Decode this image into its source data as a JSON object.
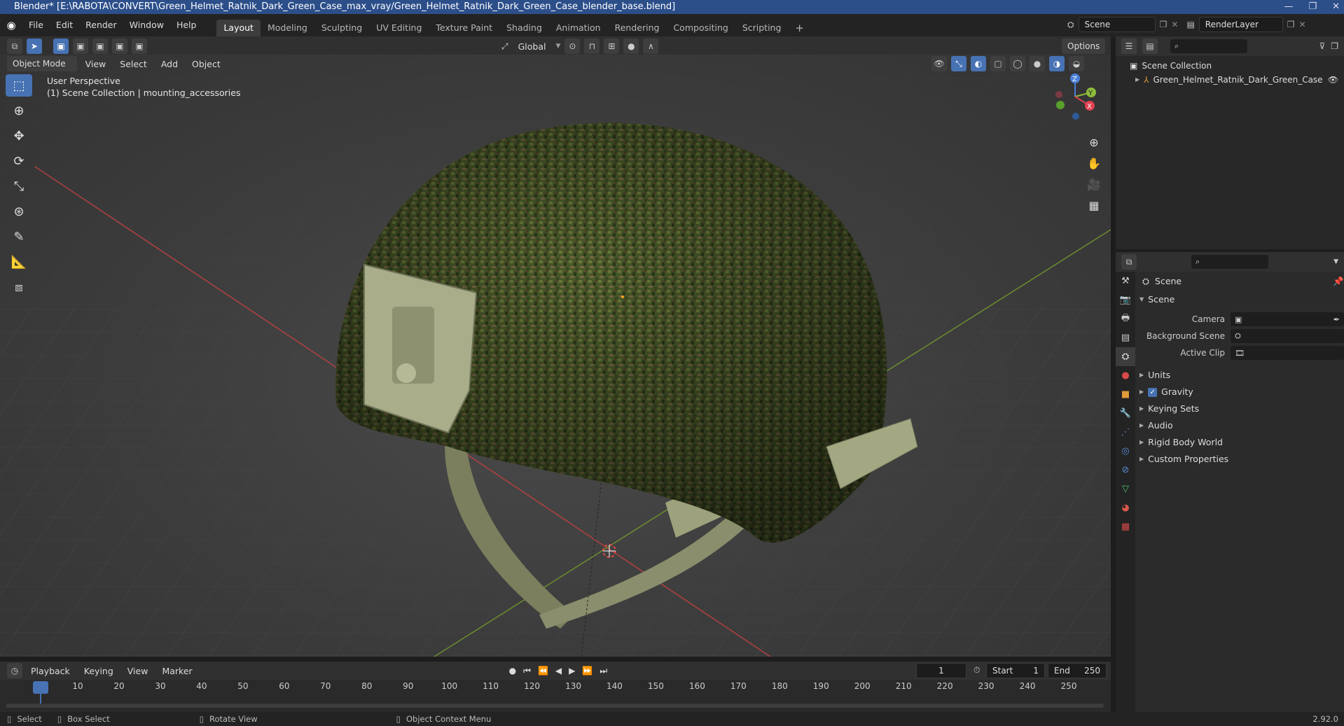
{
  "window": {
    "title": "Blender* [E:\\RABOTA\\CONVERT\\Green_Helmet_Ratnik_Dark_Green_Case_max_vray/Green_Helmet_Ratnik_Dark_Green_Case_blender_base.blend]"
  },
  "menu": [
    "File",
    "Edit",
    "Render",
    "Window",
    "Help"
  ],
  "workspaces": [
    {
      "label": "Layout",
      "active": true
    },
    {
      "label": "Modeling"
    },
    {
      "label": "Sculpting"
    },
    {
      "label": "UV Editing"
    },
    {
      "label": "Texture Paint"
    },
    {
      "label": "Shading"
    },
    {
      "label": "Animation"
    },
    {
      "label": "Rendering"
    },
    {
      "label": "Compositing"
    },
    {
      "label": "Scripting"
    }
  ],
  "scene_selector": {
    "value": "Scene"
  },
  "renderlayer_selector": {
    "value": "RenderLayer"
  },
  "viewport_header": {
    "transform_orientation": "Global",
    "options_label": "Options",
    "mode": "Object Mode",
    "menus": [
      "View",
      "Select",
      "Add",
      "Object"
    ]
  },
  "viewport": {
    "perspective_label": "User Perspective",
    "collection_label": "(1) Scene Collection | mounting_accessories",
    "gizmo": {
      "x": "X",
      "y": "Y",
      "z": "Z"
    }
  },
  "outliner": {
    "root": "Scene Collection",
    "items": [
      "Green_Helmet_Ratnik_Dark_Green_Case"
    ]
  },
  "properties": {
    "context": "Scene",
    "panel_title": "Scene",
    "fields": [
      {
        "label": "Camera",
        "value": ""
      },
      {
        "label": "Background Scene",
        "value": ""
      },
      {
        "label": "Active Clip",
        "value": ""
      }
    ],
    "sections": [
      {
        "label": "Units",
        "checkbox": false
      },
      {
        "label": "Gravity",
        "checkbox": true
      },
      {
        "label": "Keying Sets",
        "checkbox": false
      },
      {
        "label": "Audio",
        "checkbox": false
      },
      {
        "label": "Rigid Body World",
        "checkbox": false
      },
      {
        "label": "Custom Properties",
        "checkbox": false
      }
    ]
  },
  "timeline": {
    "menus": [
      "Playback",
      "Keying",
      "View",
      "Marker"
    ],
    "current_frame": "1",
    "start_label": "Start",
    "start_value": "1",
    "end_label": "End",
    "end_value": "250",
    "frame_marks": [
      "1",
      "10",
      "20",
      "30",
      "40",
      "50",
      "60",
      "70",
      "80",
      "90",
      "100",
      "110",
      "120",
      "130",
      "140",
      "150",
      "160",
      "170",
      "180",
      "190",
      "200",
      "210",
      "220",
      "230",
      "240",
      "250"
    ]
  },
  "statusbar": {
    "select": "Select",
    "box_select": "Box Select",
    "rotate_view": "Rotate View",
    "context_menu": "Object Context Menu",
    "version": "2.92.0"
  }
}
